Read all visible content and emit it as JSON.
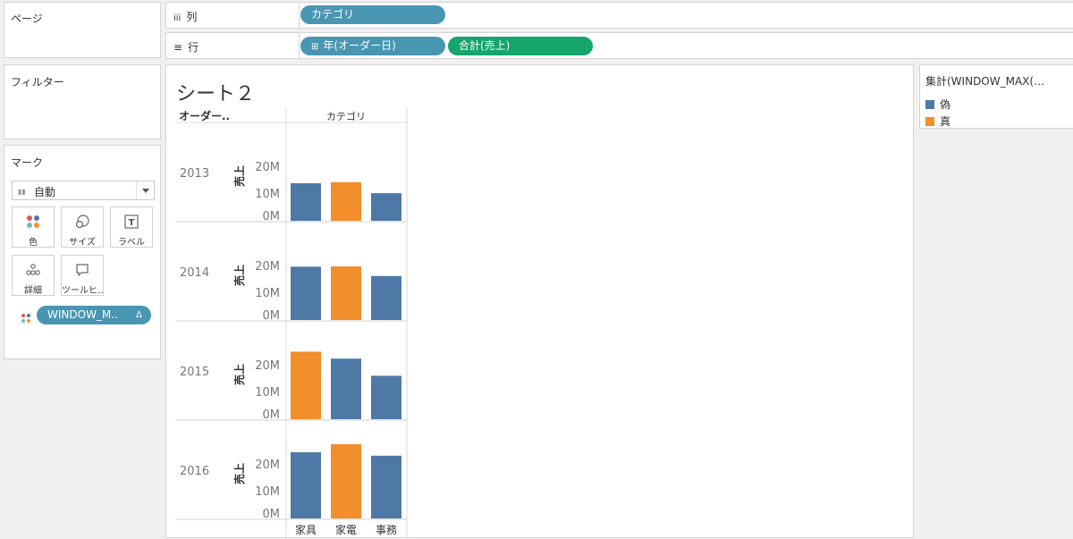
{
  "cards": {
    "pages_title": "ページ",
    "filters_title": "フィルター",
    "marks_title": "マーク",
    "mark_type": "自動",
    "buttons": {
      "color": "色",
      "size": "サイズ",
      "label": "ラベル",
      "detail": "詳細",
      "tooltip": "ツールヒ…"
    },
    "color_pill": "WINDOW_M..",
    "color_pill_delta": "Δ"
  },
  "shelves": {
    "columns_label": "列",
    "columns_icon": "iii",
    "rows_label": "行",
    "rows_icon": "≡",
    "columns_pills": [
      "カテゴリ"
    ],
    "rows_pills": [
      {
        "text": "年(オーダー日)",
        "prefix": "⊞"
      },
      {
        "text": "合計(売上)"
      }
    ]
  },
  "sheet": {
    "title": "シート２",
    "row_header": "オーダー..",
    "col_header": "カテゴリ"
  },
  "legend": {
    "title": "集計(WINDOW_MAX(…",
    "items": [
      {
        "label": "偽",
        "color": "#4e79a7"
      },
      {
        "label": "真",
        "color": "#f28e2b"
      }
    ]
  },
  "chart_data": {
    "type": "bar",
    "ylabel": "売上",
    "yticks": [
      "0M",
      "10M",
      "20M"
    ],
    "categories": [
      "家具",
      "家電",
      "事務"
    ],
    "colors": {
      "false": "#4e79a7",
      "true": "#f28e2b"
    },
    "panes": [
      {
        "year": "2013",
        "values": [
          14.0,
          14.4,
          10.3
        ],
        "max_flag": [
          false,
          true,
          false
        ]
      },
      {
        "year": "2014",
        "values": [
          19.9,
          20.0,
          16.4
        ],
        "max_flag": [
          false,
          true,
          false
        ]
      },
      {
        "year": "2015",
        "values": [
          25.2,
          22.6,
          16.2
        ],
        "max_flag": [
          true,
          false,
          false
        ]
      },
      {
        "year": "2016",
        "values": [
          24.7,
          27.7,
          23.4
        ],
        "max_flag": [
          false,
          true,
          false
        ]
      }
    ],
    "ymax": 30
  }
}
